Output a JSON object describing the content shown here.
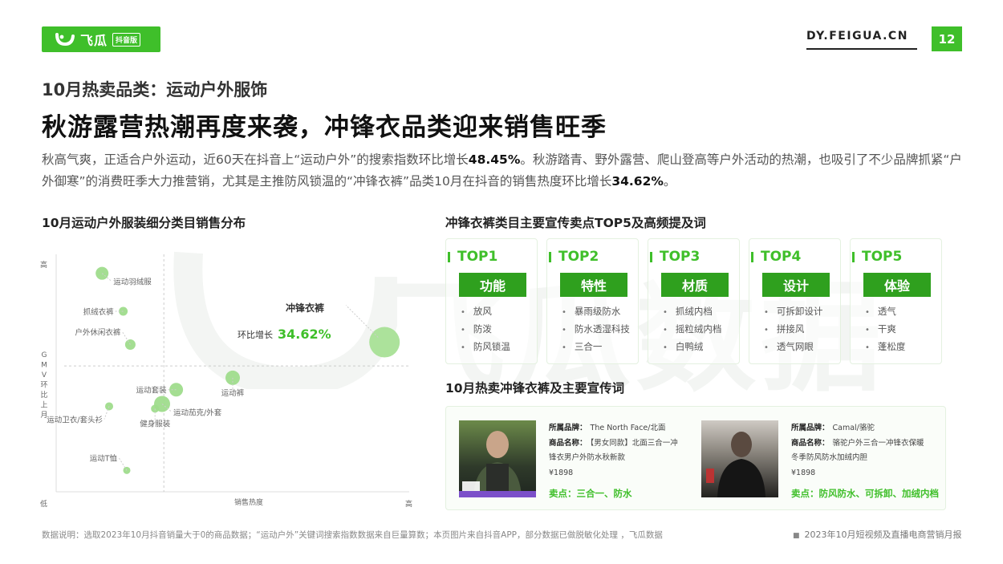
{
  "header": {
    "brand": "飞瓜",
    "brand_tag": "抖音版",
    "site": "DY.FEIGUA.CN",
    "page_number": "12"
  },
  "subtitle": "10月热卖品类：运动户外服饰",
  "title": "秋游露营热潮再度来袭，冲锋衣品类迎来销售旺季",
  "paragraph": {
    "p1": "秋高气爽，正适合户外运动，近60天在抖音上“运动户外”的搜索指数环比增长",
    "v1": "48.45%",
    "p2": "。秋游踏青、野外露营、爬山登高等户外活动的热潮，也吸引了不少品牌抓紧“户外御寒”的消费旺季大力推营销，尤其是主推防风锁温的“冲锋衣裤”品类10月在抖音的销售热度环比增长",
    "v2": "34.62%",
    "p3": "。"
  },
  "watermark": "飞瓜数据",
  "left_section_title": "10月运动户外服装细分类目销售分布",
  "chart_data": {
    "type": "scatter",
    "title": "10月运动户外服装细分类目销售分布",
    "xlabel": "销售热度",
    "ylabel": "GMV环比上月",
    "x_low": "",
    "x_high": "高",
    "y_low": "低",
    "y_high": "高",
    "xlim": [
      0,
      10
    ],
    "ylim": [
      0,
      10
    ],
    "grid": false,
    "points": [
      {
        "label": "运动羽绒服",
        "x": 1.3,
        "y": 9.2,
        "size": 8,
        "label_pos": "below-right"
      },
      {
        "label": "抓绒衣裤",
        "x": 1.9,
        "y": 7.6,
        "size": 5.5,
        "label_pos": "left"
      },
      {
        "label": "户外休闲衣裤",
        "x": 2.1,
        "y": 6.2,
        "size": 6.5,
        "label_pos": "upper-left"
      },
      {
        "label": "冲锋衣裤",
        "x": 9.3,
        "y": 6.3,
        "size": 19,
        "label_pos": "upper-left"
      },
      {
        "label": "运动裤",
        "x": 5.0,
        "y": 4.8,
        "size": 9,
        "label_pos": "below"
      },
      {
        "label": "运动套装",
        "x": 3.4,
        "y": 4.3,
        "size": 8.5,
        "label_pos": "left"
      },
      {
        "label": "运动茄克/外套",
        "x": 3.0,
        "y": 3.7,
        "size": 10,
        "label_pos": "below-right"
      },
      {
        "label": "健身服装",
        "x": 2.8,
        "y": 3.5,
        "size": 5,
        "label_pos": "below"
      },
      {
        "label": "运动卫衣/套头衫",
        "x": 1.5,
        "y": 3.6,
        "size": 5,
        "label_pos": "below-left"
      },
      {
        "label": "运动T恤",
        "x": 2.0,
        "y": 0.9,
        "size": 4.5,
        "label_pos": "upper-left"
      }
    ],
    "highlight": {
      "label": "冲锋衣裤",
      "metric_label": "环比增长",
      "metric_value": "34.62%"
    },
    "colors": {
      "bubble": "#9fdc8c",
      "bubble_big": "#a8e096",
      "text": "#666666",
      "accent": "#3fbf2a"
    }
  },
  "right_section_title": "冲锋衣裤类目主要宣传卖点TOP5及高频提及词",
  "top5": [
    {
      "rank": "TOP1",
      "category": "功能",
      "words": [
        "放风",
        "防泼",
        "防风锁温"
      ]
    },
    {
      "rank": "TOP2",
      "category": "特性",
      "words": [
        "暴雨级防水",
        "防水透湿科技",
        "三合一"
      ]
    },
    {
      "rank": "TOP3",
      "category": "材质",
      "words": [
        "抓绒内档",
        "摇粒绒内档",
        "白鸭绒"
      ]
    },
    {
      "rank": "TOP4",
      "category": "设计",
      "words": [
        "可拆卸设计",
        "拼接风",
        "透气网眼"
      ]
    },
    {
      "rank": "TOP5",
      "category": "体验",
      "words": [
        "透气",
        "干爽",
        "蓬松度"
      ]
    }
  ],
  "products_section_title": "10月热卖冲锋衣裤及主要宣传词",
  "products": [
    {
      "brand_label": "所属品牌：",
      "brand": "The North Face/北面",
      "name_label": "商品名称：",
      "name_line1": "【男女同款】北面三合一冲",
      "name_line2": "锋衣男户外防水秋新款",
      "price": "¥1898",
      "selling_points": "卖点：三合一、防水"
    },
    {
      "brand_label": "所属品牌：",
      "brand": "Camal/骆驼",
      "name_label": "商品名称：",
      "name_line1": "骆驼户外三合一冲锋衣保暖",
      "name_line2": "冬季防风防水加绒内胆",
      "price": "¥1898",
      "selling_points": "卖点：防风防水、可拆卸、加绒内档"
    }
  ],
  "footnote": "数据说明：选取2023年10月抖音销量大于0的商品数据；“运动户外”关键词搜索指数数据来自巨量算数；本页图片来自抖音APP，部分数据已做脱敏化处理 ，飞瓜数据",
  "report_name": "2023年10月短视频及直播电商营销月报"
}
